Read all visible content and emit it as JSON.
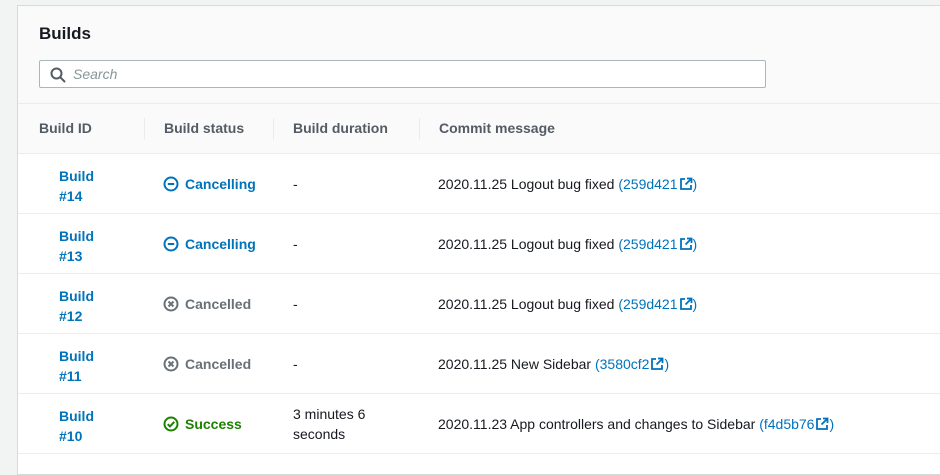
{
  "panel": {
    "title": "Builds",
    "search": {
      "placeholder": "Search",
      "value": ""
    }
  },
  "columns": {
    "build_id": "Build ID",
    "build_status": "Build status",
    "build_duration": "Build duration",
    "commit_message": "Commit message"
  },
  "rows": [
    {
      "build_line1": "Build",
      "build_line2": "#14",
      "status": "Cancelling",
      "status_kind": "cancelling",
      "duration_line1": "-",
      "duration_line2": "",
      "commit_text": "2020.11.25 Logout bug fixed ",
      "commit_hash": "(259d421",
      "commit_close": ")"
    },
    {
      "build_line1": "Build",
      "build_line2": "#13",
      "status": "Cancelling",
      "status_kind": "cancelling",
      "duration_line1": "-",
      "duration_line2": "",
      "commit_text": "2020.11.25 Logout bug fixed ",
      "commit_hash": "(259d421",
      "commit_close": ")"
    },
    {
      "build_line1": "Build",
      "build_line2": "#12",
      "status": "Cancelled",
      "status_kind": "cancelled",
      "duration_line1": "-",
      "duration_line2": "",
      "commit_text": "2020.11.25 Logout bug fixed ",
      "commit_hash": "(259d421",
      "commit_close": ")"
    },
    {
      "build_line1": "Build",
      "build_line2": "#11",
      "status": "Cancelled",
      "status_kind": "cancelled",
      "duration_line1": "-",
      "duration_line2": "",
      "commit_text": "2020.11.25 New Sidebar ",
      "commit_hash": "(3580cf2",
      "commit_close": ")"
    },
    {
      "build_line1": "Build",
      "build_line2": "#10",
      "status": "Success",
      "status_kind": "success",
      "duration_line1": "3 minutes 6",
      "duration_line2": "seconds",
      "commit_text": "2020.11.23 App controllers and changes to Sidebar ",
      "commit_hash": "(f4d5b76",
      "commit_close": ")"
    }
  ],
  "colors": {
    "link": "#0073bb",
    "success": "#1d8102",
    "cancelled": "#687078"
  },
  "icons": {
    "search": "search-icon",
    "cancelling": "minus-circle-icon",
    "cancelled": "x-circle-icon",
    "success": "check-circle-icon",
    "external": "external-link-icon"
  }
}
